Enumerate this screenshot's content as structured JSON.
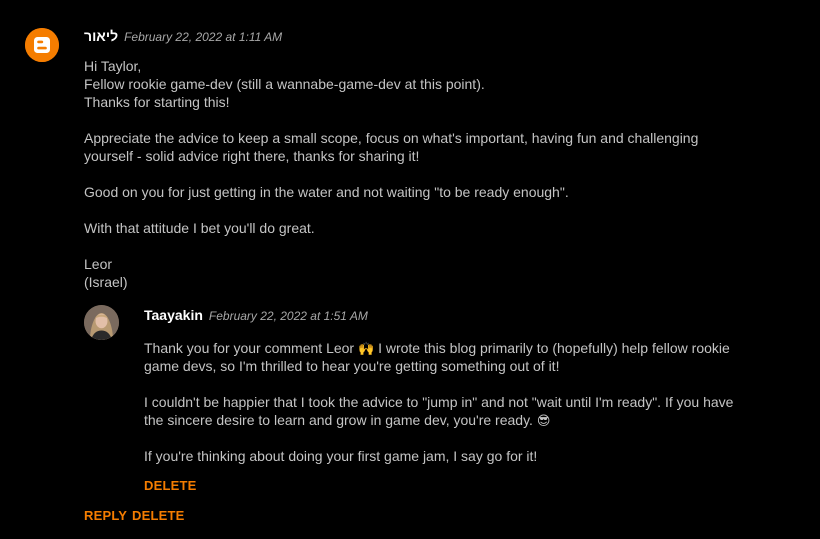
{
  "comment": {
    "author": "ליאור",
    "timestamp": "February 22, 2022 at 1:11 AM",
    "paragraphs": [
      {
        "lines": [
          "Hi Taylor,",
          "Fellow rookie game-dev (still a wannabe-game-dev at this point).",
          "Thanks for starting this!"
        ]
      },
      {
        "lines": [
          "Appreciate the advice to keep a small scope, focus on what's important, having fun and challenging",
          "yourself - solid advice right there, thanks for sharing it!"
        ]
      },
      {
        "lines": [
          "Good on you for just getting in the water and not waiting \"to be ready enough\"."
        ]
      },
      {
        "lines": [
          "With that attitude I bet you'll do great."
        ]
      },
      {
        "lines": [
          "Leor",
          "(Israel)"
        ]
      }
    ],
    "reply_label": "REPLY",
    "delete_label": "DELETE"
  },
  "reply": {
    "author": "Taayakin",
    "timestamp": "February 22, 2022 at 1:51 AM",
    "p1_line1_a": "Thank you for your comment Leor ",
    "p1_emoji": "🙌",
    "p1_line1_b": " I wrote this blog primarily to (hopefully) help fellow rookie",
    "p1_line2": "game devs, so I'm thrilled to hear you're getting something out of it!",
    "p2_line1": "I couldn't be happier that I took the advice to \"jump in\" and not \"wait until I'm ready\". If you have",
    "p2_line2_a": "the sincere desire to learn and grow in game dev, you're ready. ",
    "p2_emoji": "😎",
    "p3_line1": "If you're thinking about doing your first game jam, I say go for it!",
    "delete_label": "DELETE"
  },
  "icons": {
    "commenter_avatar": "blogger-icon",
    "reply_avatar": "user-photo-avatar"
  },
  "colors": {
    "background": "#000000",
    "accent": "#f57d00",
    "text": "#c4c4c4",
    "author": "#ffffff",
    "timestamp": "#a8a8a8"
  }
}
